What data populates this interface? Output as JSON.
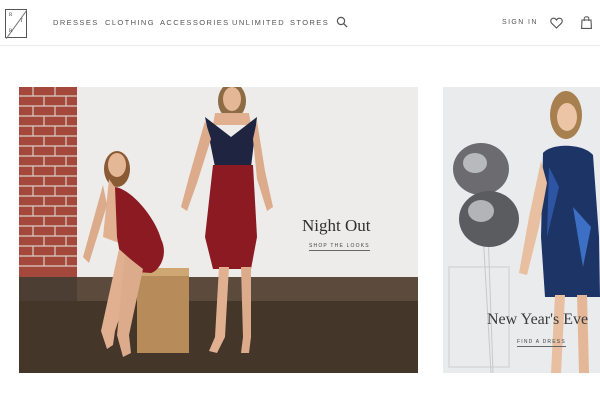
{
  "header": {
    "logo_letters": [
      "R",
      "T",
      "R",
      ""
    ],
    "nav": [
      {
        "label": "DRESSES"
      },
      {
        "label": "CLOTHING"
      },
      {
        "label": "ACCESSORIES"
      },
      {
        "label": "UNLIMITED"
      },
      {
        "label": "STORES"
      }
    ],
    "sign_in_label": "SIGN IN",
    "icons": [
      "search-icon",
      "heart-icon",
      "bag-icon"
    ]
  },
  "hero": [
    {
      "title": "Night Out",
      "link_label": "SHOP THE LOOKS"
    },
    {
      "title": "New Year's Eve",
      "link_label": "FIND A DRESS"
    }
  ],
  "colors": {
    "accent": "#8b1a22",
    "navy": "#1f2541",
    "text": "#555555",
    "background": "#ffffff"
  }
}
